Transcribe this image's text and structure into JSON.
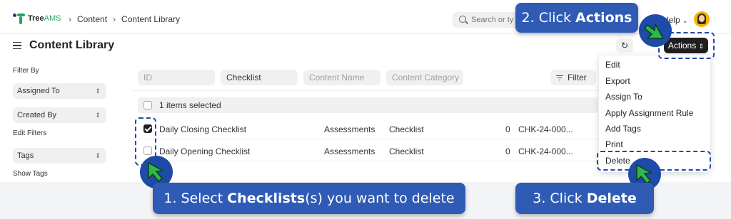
{
  "topbar": {
    "logo_name": "Tree",
    "logo_suffix": "AMS",
    "breadcrumbs": [
      "Content",
      "Content Library"
    ],
    "search_placeholder": "Search or ty",
    "help_label": "Help"
  },
  "header": {
    "title": "Content Library",
    "refresh_icon": "↻",
    "actions_label": "Actions",
    "actions_icon": "⇕"
  },
  "sidebar": {
    "filter_by_label": "Filter By",
    "assigned_to": "Assigned To",
    "created_by": "Created By",
    "edit_filters": "Edit Filters",
    "tags": "Tags",
    "show_tags": "Show Tags"
  },
  "filters": {
    "id_placeholder": "ID",
    "type_value": "Checklist",
    "content_name_placeholder": "Content Name",
    "content_category_placeholder": "Content Category",
    "filter_label": "Filter"
  },
  "selection": {
    "text": "1 items selected"
  },
  "rows": [
    {
      "title": "Daily Closing Checklist",
      "category": "Assessments",
      "type": "Checklist",
      "count": "0",
      "code": "CHK-24-000...",
      "checked": true
    },
    {
      "title": "Daily Opening Checklist",
      "category": "Assessments",
      "type": "Checklist",
      "count": "0",
      "code": "CHK-24-000...",
      "checked": false
    }
  ],
  "actions_menu": [
    "Edit",
    "Export",
    "Assign To",
    "Apply Assignment Rule",
    "Add Tags",
    "Print",
    "Delete"
  ],
  "callouts": {
    "step1": {
      "prefix": "1. Select ",
      "bold": "Checklists",
      "suffix": "(s) you want to delete"
    },
    "step2": {
      "prefix": "2. Click ",
      "bold": "Actions"
    },
    "step3": {
      "prefix": "3. Click ",
      "bold": "Delete"
    }
  },
  "colors": {
    "callout_bg": "#2f5bb5",
    "dash": "#1e4aa8",
    "cursor": "#2eb84a",
    "brand_green": "#22a95a"
  }
}
